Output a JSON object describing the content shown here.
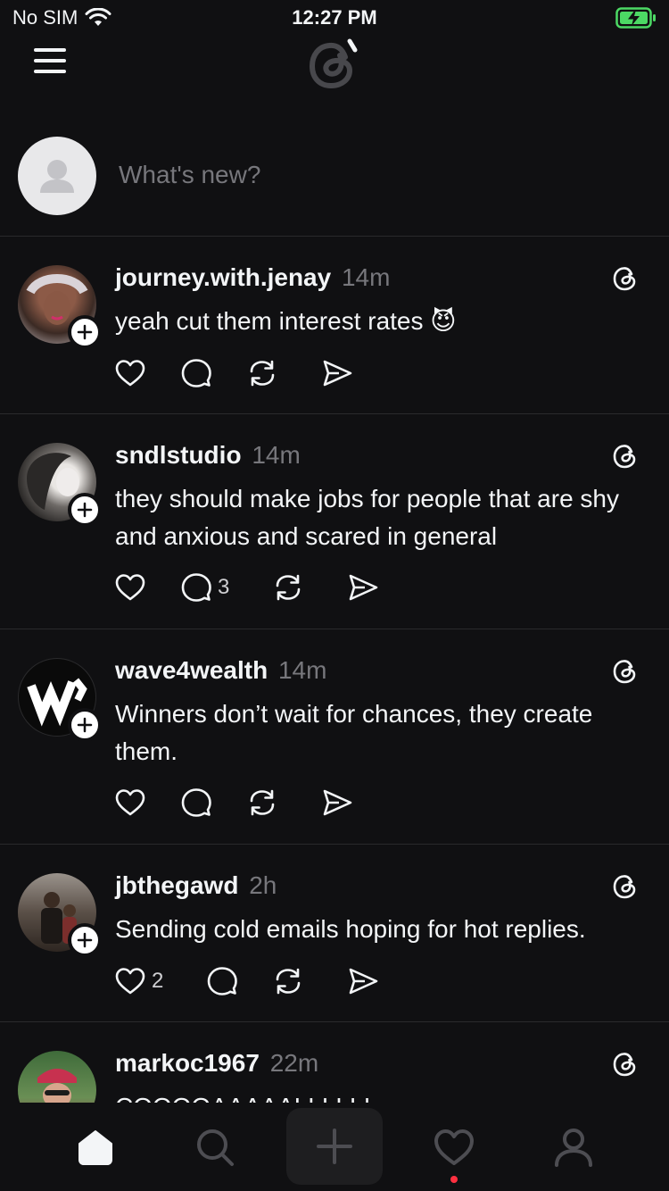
{
  "status_bar": {
    "carrier": "No SIM",
    "time": "12:27 PM"
  },
  "composer": {
    "placeholder": "What's new?"
  },
  "posts": [
    {
      "username": "journey.with.jenay",
      "time": "14m",
      "text": "yeah cut them interest rates 😈",
      "likes": "",
      "replies": ""
    },
    {
      "username": "sndlstudio",
      "time": "14m",
      "text": "they should make jobs for people that are shy and anxious and scared in general",
      "likes": "",
      "replies": "3"
    },
    {
      "username": "wave4wealth",
      "time": "14m",
      "text": "Winners don’t wait for chances, they create them.",
      "likes": "",
      "replies": ""
    },
    {
      "username": "jbthegawd",
      "time": "2h",
      "text": "Sending cold emails hoping for hot replies.",
      "likes": "2",
      "replies": ""
    },
    {
      "username": "markoc1967",
      "time": "22m",
      "text": "COOOOAAAAALLLLL!",
      "likes": "",
      "replies": ""
    }
  ],
  "tabbar": {
    "items": [
      "home-tab",
      "search-tab",
      "new-thread-tab",
      "activity-tab",
      "profile-tab"
    ]
  },
  "colors": {
    "background": "#101012",
    "text": "#f3f5f7",
    "muted": "#77777c",
    "notification": "#ff3040",
    "battery": "#4cd964"
  },
  "icons": {
    "menu": "hamburger-icon",
    "logo": "threads-logo",
    "like": "heart-icon",
    "reply": "comment-icon",
    "repost": "repost-icon",
    "share": "send-icon"
  }
}
